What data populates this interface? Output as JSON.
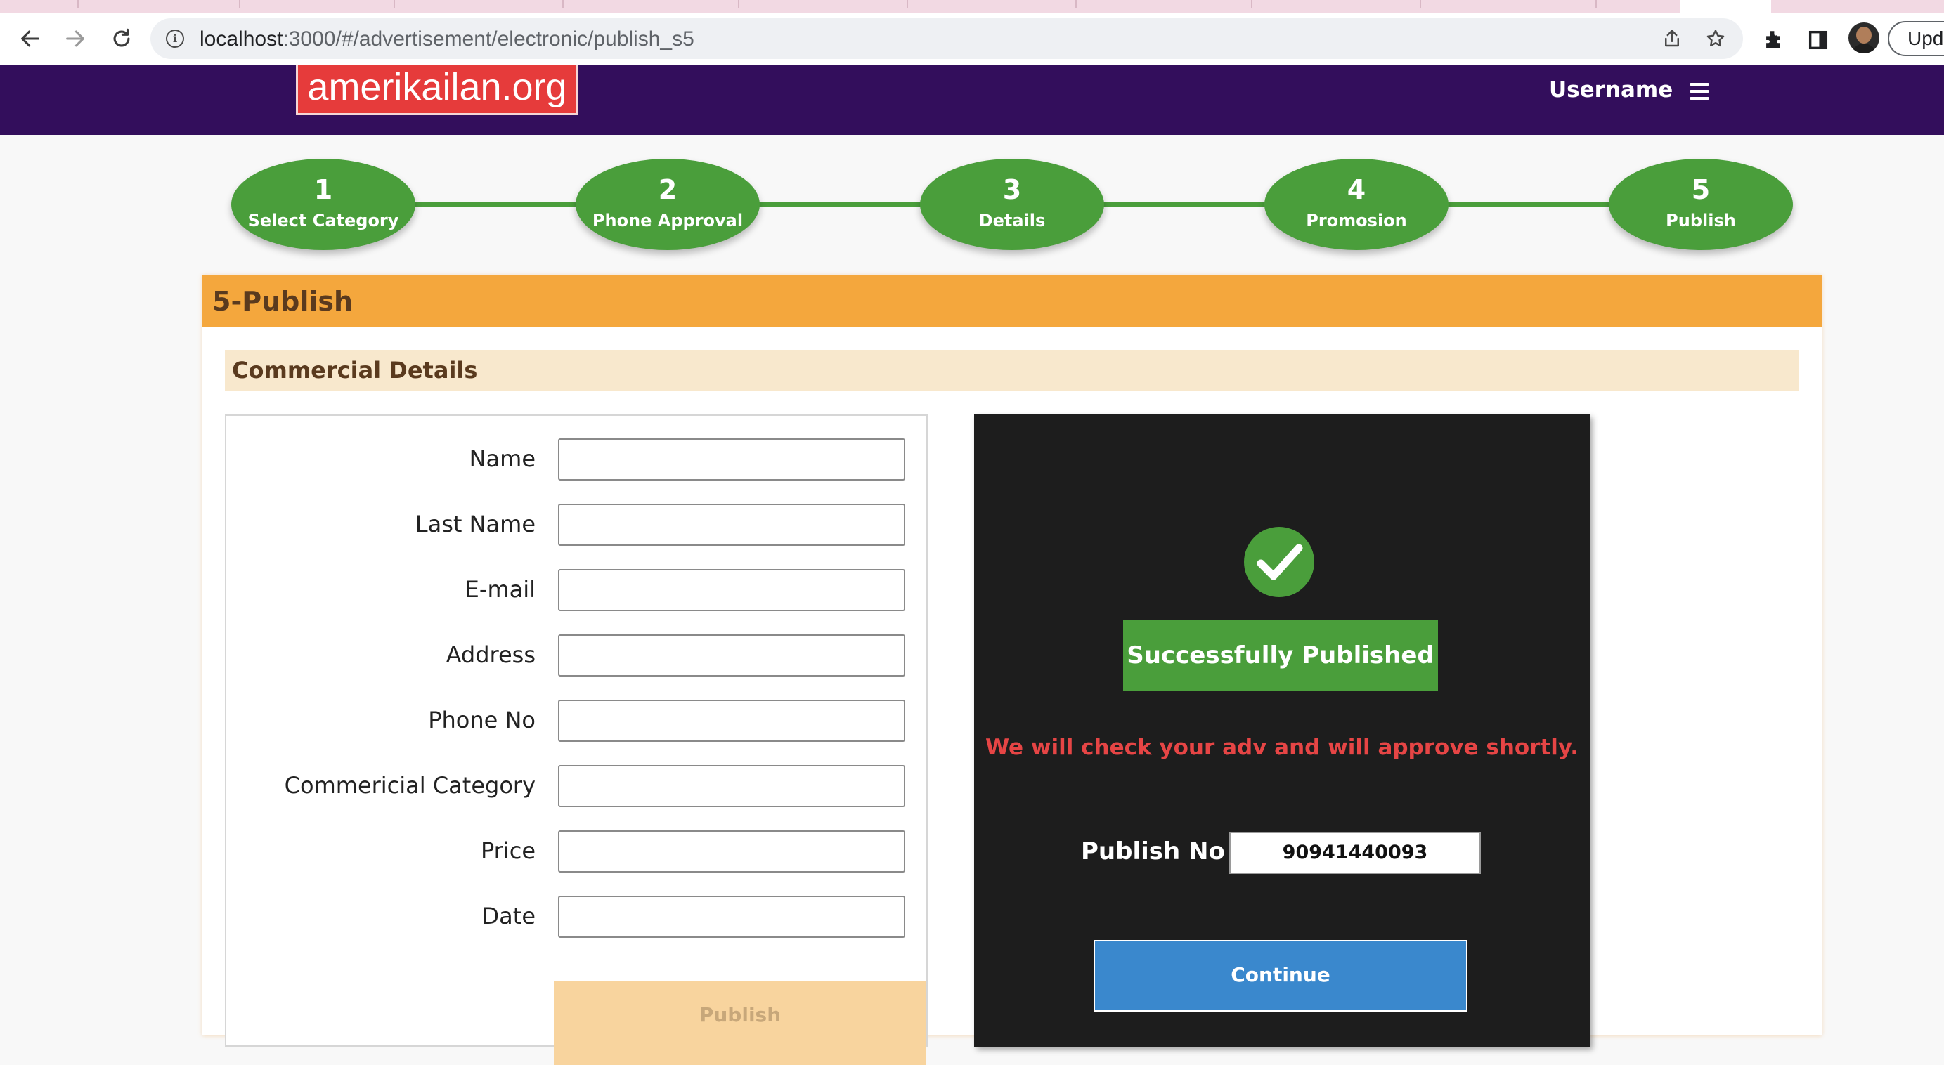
{
  "browser": {
    "url_host": "localhost",
    "url_rest": ":3000/#/advertisement/electronic/publish_s5",
    "update_label": "Upd"
  },
  "header": {
    "logo_text": "amerikailan.org",
    "username": "Username"
  },
  "steps": [
    {
      "num": "1",
      "label": "Select Category"
    },
    {
      "num": "2",
      "label": "Phone Approval"
    },
    {
      "num": "3",
      "label": "Details"
    },
    {
      "num": "4",
      "label": "Promosion"
    },
    {
      "num": "5",
      "label": "Publish"
    }
  ],
  "page": {
    "section_title": "5-Publish",
    "subsection_title": "Commercial Details"
  },
  "form": {
    "fields": [
      {
        "label": "Name",
        "value": ""
      },
      {
        "label": "Last Name",
        "value": ""
      },
      {
        "label": "E-mail",
        "value": ""
      },
      {
        "label": "Address",
        "value": ""
      },
      {
        "label": "Phone No",
        "value": ""
      },
      {
        "label": "Commericial Category",
        "value": ""
      },
      {
        "label": "Price",
        "value": ""
      },
      {
        "label": "Date",
        "value": ""
      }
    ],
    "publish_label": "Publish"
  },
  "result": {
    "success_text": "Successfully Published",
    "notice_text": "We will check your adv and will approve shortly.",
    "publish_no_label": "Publish No",
    "publish_no_value": "90941440093",
    "continue_label": "Continue"
  },
  "colors": {
    "header_bg": "#330e5c",
    "step_green": "#4a9e3b",
    "section_orange": "#f4a73d",
    "notice_red": "#e64545",
    "continue_blue": "#3a88cd"
  }
}
